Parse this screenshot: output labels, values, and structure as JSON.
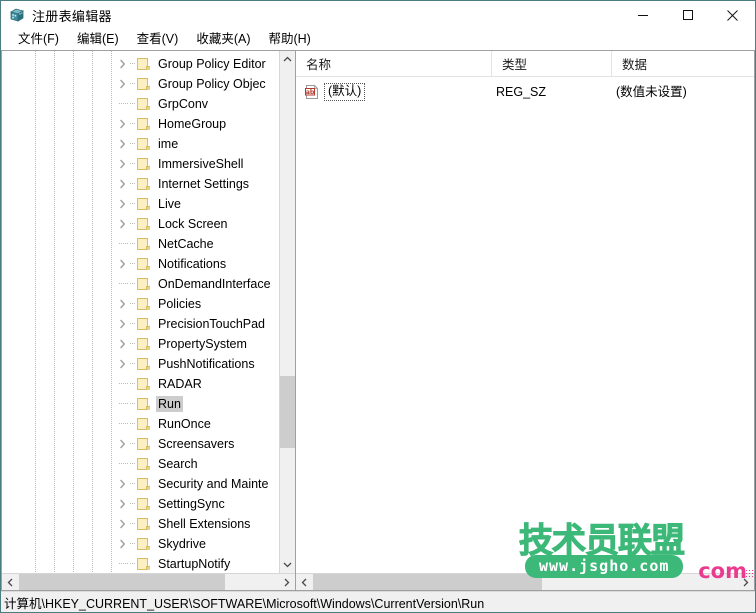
{
  "window": {
    "title": "注册表编辑器",
    "app_icon": "registry-editor-icon",
    "minimize_label": "最小化",
    "maximize_label": "最大化",
    "close_label": "关闭"
  },
  "menubar": {
    "items": [
      {
        "label": "文件(F)",
        "name": "menu-file"
      },
      {
        "label": "编辑(E)",
        "name": "menu-edit"
      },
      {
        "label": "查看(V)",
        "name": "menu-view"
      },
      {
        "label": "收藏夹(A)",
        "name": "menu-favorites"
      },
      {
        "label": "帮助(H)",
        "name": "menu-help"
      }
    ]
  },
  "tree": {
    "items": [
      {
        "label": "Group Policy Editor",
        "expandable": true,
        "selected": false
      },
      {
        "label": "Group Policy Objec",
        "expandable": true,
        "selected": false
      },
      {
        "label": "GrpConv",
        "expandable": false,
        "selected": false
      },
      {
        "label": "HomeGroup",
        "expandable": true,
        "selected": false
      },
      {
        "label": "ime",
        "expandable": true,
        "selected": false
      },
      {
        "label": "ImmersiveShell",
        "expandable": true,
        "selected": false
      },
      {
        "label": "Internet Settings",
        "expandable": true,
        "selected": false
      },
      {
        "label": "Live",
        "expandable": true,
        "selected": false
      },
      {
        "label": "Lock Screen",
        "expandable": true,
        "selected": false
      },
      {
        "label": "NetCache",
        "expandable": false,
        "selected": false
      },
      {
        "label": "Notifications",
        "expandable": true,
        "selected": false
      },
      {
        "label": "OnDemandInterface",
        "expandable": false,
        "selected": false
      },
      {
        "label": "Policies",
        "expandable": true,
        "selected": false
      },
      {
        "label": "PrecisionTouchPad",
        "expandable": true,
        "selected": false
      },
      {
        "label": "PropertySystem",
        "expandable": true,
        "selected": false
      },
      {
        "label": "PushNotifications",
        "expandable": true,
        "selected": false
      },
      {
        "label": "RADAR",
        "expandable": false,
        "selected": false
      },
      {
        "label": "Run",
        "expandable": false,
        "selected": true
      },
      {
        "label": "RunOnce",
        "expandable": false,
        "selected": false
      },
      {
        "label": "Screensavers",
        "expandable": true,
        "selected": false
      },
      {
        "label": "Search",
        "expandable": false,
        "selected": false
      },
      {
        "label": "Security and Mainte",
        "expandable": true,
        "selected": false
      },
      {
        "label": "SettingSync",
        "expandable": true,
        "selected": false
      },
      {
        "label": "Shell Extensions",
        "expandable": true,
        "selected": false
      },
      {
        "label": "Skydrive",
        "expandable": true,
        "selected": false
      },
      {
        "label": "StartupNotify",
        "expandable": false,
        "selected": false
      }
    ]
  },
  "list": {
    "columns": [
      {
        "label": "名称",
        "name": "column-name"
      },
      {
        "label": "类型",
        "name": "column-type"
      },
      {
        "label": "数据",
        "name": "column-data"
      }
    ],
    "rows": [
      {
        "icon": "string-value-icon",
        "name": "(默认)",
        "type": "REG_SZ",
        "data": "(数值未设置)"
      }
    ]
  },
  "statusbar": {
    "path": "计算机\\HKEY_CURRENT_USER\\SOFTWARE\\Microsoft\\Windows\\CurrentVersion\\Run"
  },
  "watermark": {
    "chinese": "技术员联盟",
    "url": "www.jsgho.com",
    "fragment": "com",
    "green": "#3cb878",
    "pink": "#ea3c8f"
  },
  "scrollbars": {
    "tree_vertical_up": "▲",
    "tree_vertical_down": "▼",
    "tree_horizontal_left": "◀",
    "tree_horizontal_right": "▶"
  }
}
